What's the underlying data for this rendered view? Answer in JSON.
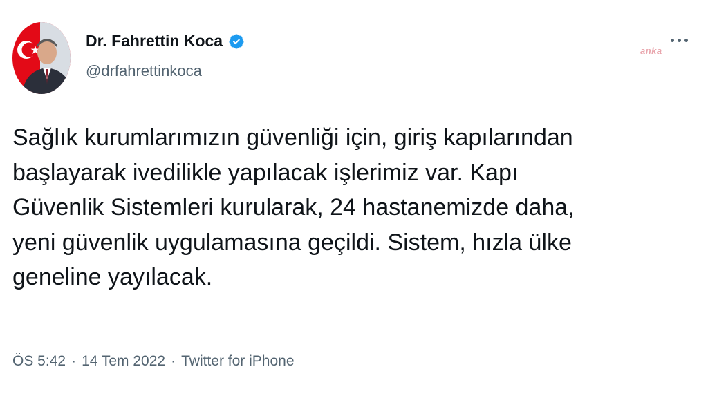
{
  "author": {
    "display_name": "Dr. Fahrettin Koca",
    "handle": "@drfahrettinkoca",
    "verified": true
  },
  "watermark": "anka",
  "tweet": {
    "text": "Sağlık kurumlarımızın güvenliği için, giriş kapılarından\nbaşlayarak ivedilikle yapılacak işlerimiz var. Kapı\nGüvenlik Sistemleri kurularak, 24 hastanemizde daha,\nyeni güvenlik uygulamasına geçildi. Sistem, hızla ülke\ngeneline yayılacak.",
    "time": "ÖS 5:42",
    "separator_1": "·",
    "date": "14 Tem 2022",
    "separator_2": "·",
    "source": "Twitter for iPhone"
  },
  "icons": {
    "verified": "verified-badge-icon",
    "more": "more-options-icon"
  },
  "colors": {
    "text_primary": "#0f1419",
    "text_secondary": "#536471",
    "verified_blue": "#1d9bf0",
    "flag_red": "#e30a17"
  }
}
